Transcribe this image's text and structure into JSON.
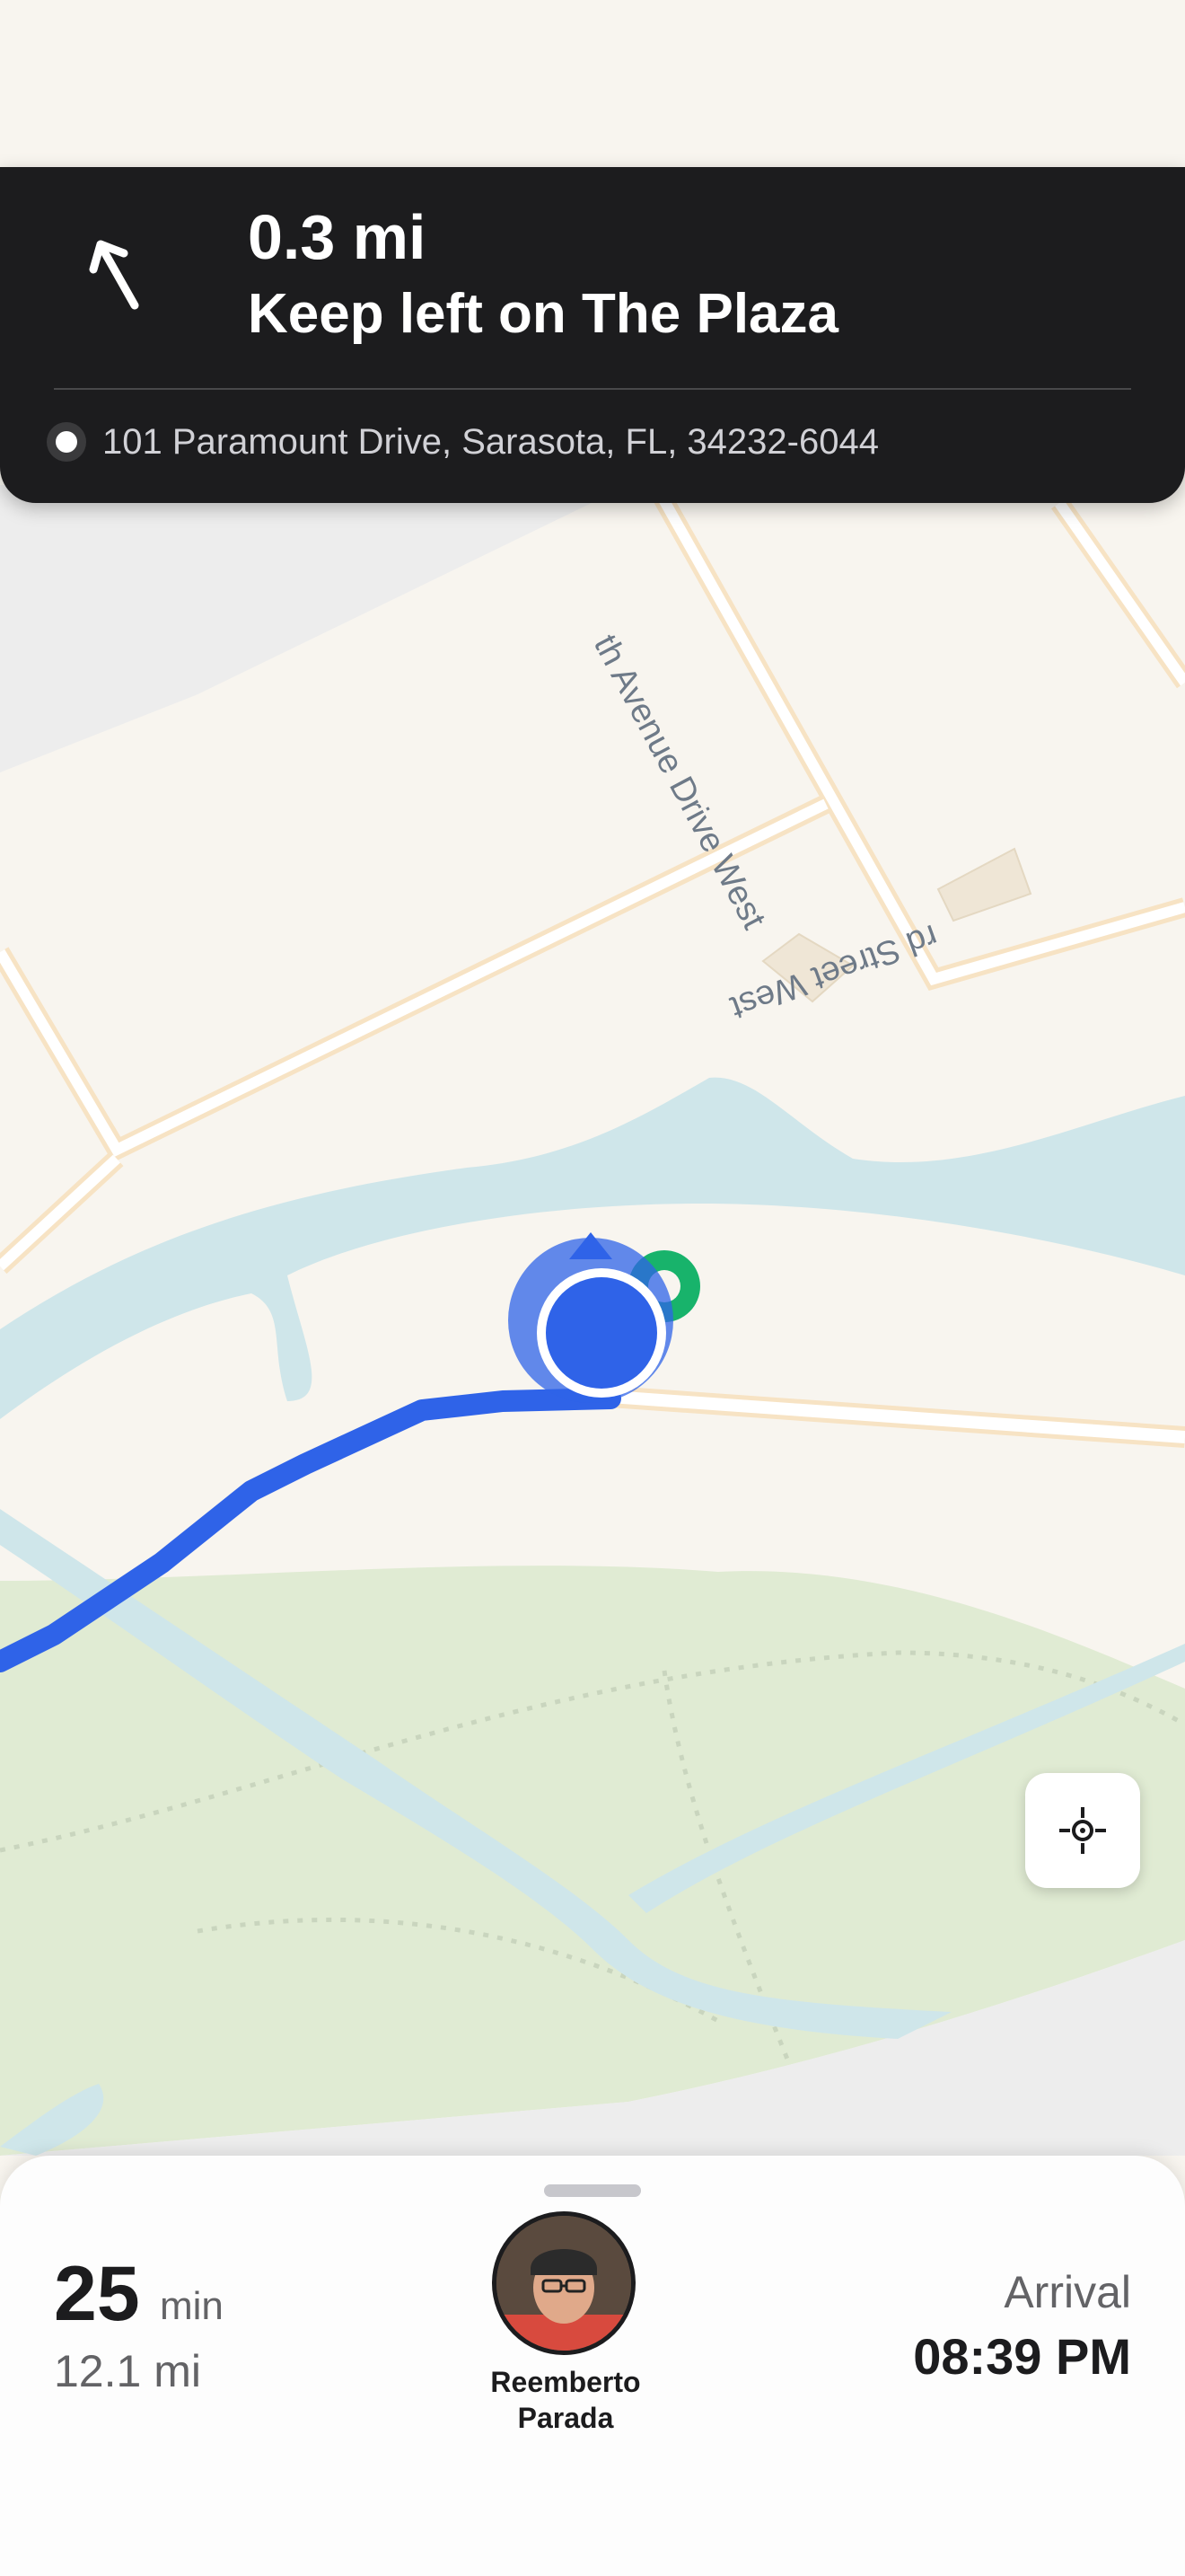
{
  "navigation": {
    "distance": "0.3 mi",
    "instruction": "Keep left on The Plaza",
    "destination_address": "101 Paramount Drive, Sarasota, FL, 34232-6044",
    "turn_icon": "keep-left-arrow-icon"
  },
  "map": {
    "street_labels": [
      "th Avenue Drive West",
      "rd Street West"
    ],
    "recenter_icon": "crosshair-icon",
    "route_color": "#2f63e8",
    "water_color": "#cfe6ea",
    "park_color": "#e0ebd3",
    "land_color": "#f8f5ef"
  },
  "trip": {
    "eta_value": "25",
    "eta_unit": "min",
    "distance_remaining": "12.1 mi",
    "arrival_label": "Arrival",
    "arrival_time": "08:39 PM"
  },
  "driver": {
    "first_name": "Reemberto",
    "last_name": "Parada"
  }
}
